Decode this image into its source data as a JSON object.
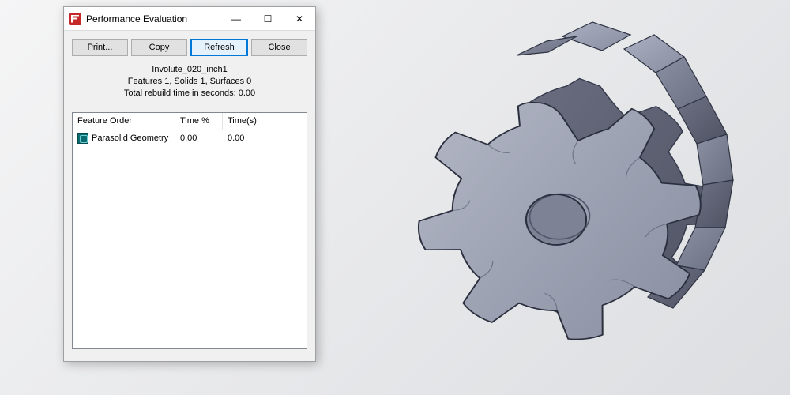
{
  "dialog": {
    "title": "Performance Evaluation",
    "buttons": {
      "print": "Print...",
      "copy": "Copy",
      "refresh": "Refresh",
      "close": "Close"
    },
    "summary": {
      "line1": "Involute_020_inch1",
      "line2": "Features 1, Solids 1, Surfaces 0",
      "line3": "Total rebuild time in seconds: 0.00"
    },
    "columns": {
      "feature": "Feature Order",
      "timepct": "Time %",
      "times": "Time(s)"
    },
    "rows": [
      {
        "feature": "Parasolid Geometry",
        "timepct": "0.00",
        "times": "0.00"
      }
    ]
  },
  "window_controls": {
    "minimize_glyph": "—",
    "maximize_glyph": "☐",
    "close_glyph": "✕"
  }
}
